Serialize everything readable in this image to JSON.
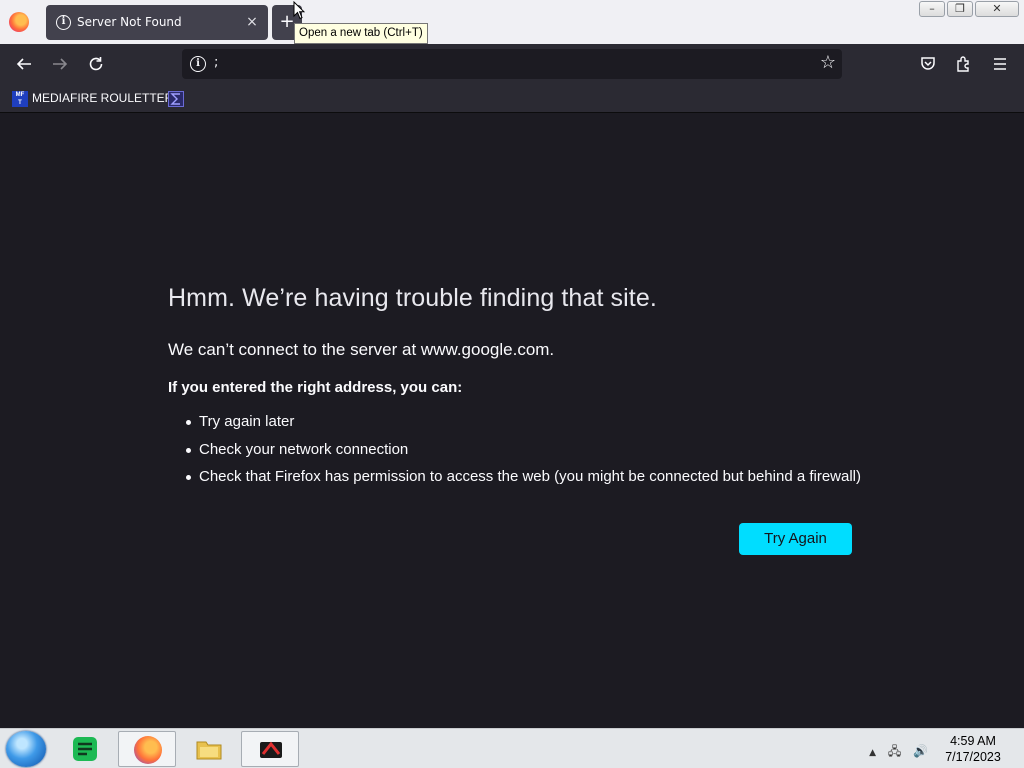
{
  "tab": {
    "title": "Server Not Found",
    "close_glyph": "×",
    "new_tab_glyph": "+"
  },
  "tooltip": "Open a new tab (Ctrl+T)",
  "window_controls": {
    "minimize": "–",
    "restore": "❐",
    "close": "✕"
  },
  "urlbar": {
    "value": ";"
  },
  "bookmarks": [
    {
      "label": "MEDIAFIRE ROULETTER",
      "favicon": "MF T"
    },
    {
      "label": ""
    }
  ],
  "error": {
    "title": "Hmm. We’re having trouble finding that site.",
    "description": "We can’t connect to the server at www.google.com.",
    "subheading": "If you entered the right address, you can:",
    "suggestions": [
      "Try again later",
      "Check your network connection",
      "Check that Firefox has permission to access the web (you might be connected but behind a firewall)"
    ],
    "button_label": "Try Again",
    "button_color": "#00ddff"
  },
  "taskbar": {
    "clock_time": "4:59 AM",
    "clock_date": "7/17/2023"
  },
  "colors": {
    "page_bg": "#1c1b22",
    "toolbar_bg": "#2b2a33",
    "tab_bg": "#42414d"
  }
}
